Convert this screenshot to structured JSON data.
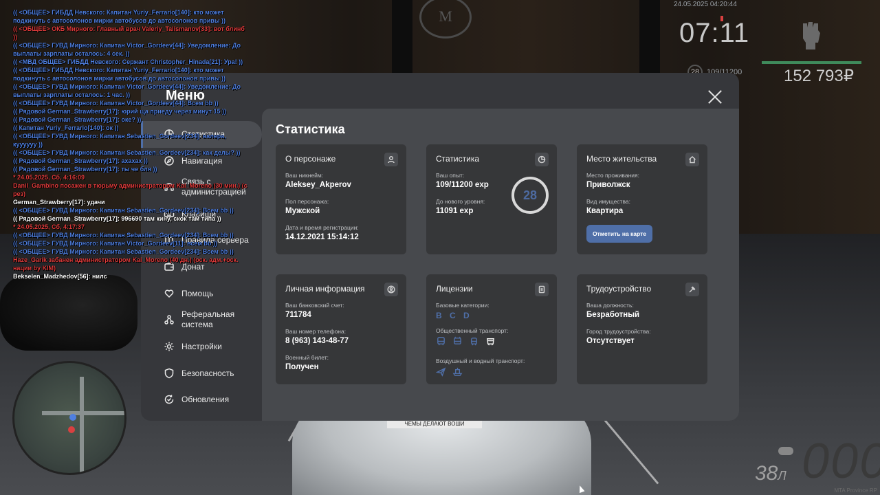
{
  "chat": [
    {
      "color": "blue",
      "text": "(( <ОБЩЕЕ> ГИБДД Невского: Капитан Yuriy_Ferrario[140]: кто может подкинуть с автосолонов мирки автобусов до автосолонов привы ))"
    },
    {
      "color": "red",
      "text": "(( <ОБЩЕЕ> ОКБ Мирного: Главный врач Valeriy_Talismanov[33]: вот блинб ))"
    },
    {
      "color": "blue",
      "text": "(( <ОБЩЕЕ> ГУВД Мирного: Капитан Victor_Gordeev[44]: Уведомление: До выплаты зарплаты осталось: 4 сек. ))"
    },
    {
      "color": "blue",
      "text": "(( <МВД ОБЩЕЕ> ГИБДД Невского: Сержант Christopher_Hinada[21]: Ура! ))"
    },
    {
      "color": "blue",
      "text": "(( <ОБЩЕЕ> ГИБДД Невского: Капитан Yuriy_Ferrario[140]: кто может подкинуть с автосолонов мирки автобусов до автосолонов привы ))"
    },
    {
      "color": "blue",
      "text": "(( <ОБЩЕЕ> ГУВД Мирного: Капитан Victor_Gordeev[44]: Уведомление: До выплаты зарплаты осталось: 1 час. ))"
    },
    {
      "color": "blue",
      "text": "(( <ОБЩЕЕ> ГУВД Мирного: Капитан Victor_Gordeev[44]: Всем bb ))"
    },
    {
      "color": "blue",
      "text": "(( Рядовой German_Strawberry[17]: юрий ща приеду через минут 15 ))"
    },
    {
      "color": "blue",
      "text": "(( Рядовой German_Strawberry[17]: оке? ))"
    },
    {
      "color": "blue",
      "text": "(( Капитан Yuriy_Ferrario[140]: ок ))"
    },
    {
      "color": "blue",
      "text": "(( <ОБЩЕЕ> ГУВД Мирного: Капитан Sebastien_Gordeev[234]: валера, куууууу ))"
    },
    {
      "color": "blue",
      "text": "(( <ОБЩЕЕ> ГУВД Мирного: Капитан Sebastien_Gordeev[234]: как делы? ))"
    },
    {
      "color": "blue",
      "text": "(( Рядовой German_Strawberry[17]: ахахах ))"
    },
    {
      "color": "blue",
      "text": "(( Рядовой German_Strawberry[17]: ты че бля ))"
    },
    {
      "color": "red",
      "text": "* 24.05.2025, Сб, 4:16:09"
    },
    {
      "color": "red",
      "text": "Danil_Gambino посажен в тюрьму администратором Kai_Moreno (30 мин.) (с рез)"
    },
    {
      "color": "white",
      "text": "German_Strawberry[17]: удачи"
    },
    {
      "color": "blue",
      "text": "(( <ОБЩЕЕ> ГУВД Мирного: Капитан Sebastien_Gordeev[234]: Всем bb ))"
    },
    {
      "color": "white",
      "text": "(( Рядовой German_Strawberry[17]: 996690 там кину, скок там типа ))"
    },
    {
      "color": "red",
      "text": "* 24.05.2025, Сб, 4:17:37"
    },
    {
      "color": "blue",
      "text": "(( <ОБЩЕЕ> ГУВД Мирного: Капитан Sebastien_Gordeev[234]: Всем bb ))"
    },
    {
      "color": "blue",
      "text": "(( <ОБЩЕЕ> ГУВД Мирного: Капитан Victor_Gordeev[11]: всем bb ))"
    },
    {
      "color": "blue",
      "text": "(( <ОБЩЕЕ> ГУВД Мирного: Капитан Sebastien_Gordeev[234]: Всем bb ))"
    },
    {
      "color": "red",
      "text": "Haze_Garik забанен администратором Kai_Moreno (40 дн.) (оск. адм.+оск. нации by KIM)"
    },
    {
      "color": "white",
      "text": "Bekselen_Madzhedov[56]: нилс"
    }
  ],
  "hud": {
    "datetime": "24.05.2025 04:20:44",
    "time": "07:11",
    "level": "28",
    "exp": "109/11200",
    "money": "152 793₽",
    "speed": "000",
    "fuel": "38",
    "fuel_unit": "Л",
    "watermark": "MTA Province RP"
  },
  "plate": "ЧЕМЫ ДЕЛАЮТ ВОШИ",
  "emblem": "M",
  "menu": {
    "title": "Меню",
    "nav": [
      {
        "name": "nav-statistics",
        "icon": "pie-chart-icon",
        "label": "Статистика",
        "active": true
      },
      {
        "name": "nav-navigation",
        "icon": "compass-icon",
        "label": "Навигация"
      },
      {
        "name": "nav-administration",
        "icon": "headset-icon",
        "label": "Связь с администрацией"
      },
      {
        "name": "nav-hotkeys",
        "icon": "keyboard-icon",
        "label": "Клавиши"
      },
      {
        "name": "nav-rules",
        "icon": "book-icon",
        "label": "Правила сервера"
      },
      {
        "name": "nav-donate",
        "icon": "wallet-icon",
        "label": "Донат"
      },
      {
        "name": "nav-help",
        "icon": "heart-hand-icon",
        "label": "Помощь"
      },
      {
        "name": "nav-referral",
        "icon": "network-icon",
        "label": "Реферальная система"
      },
      {
        "name": "nav-settings",
        "icon": "gear-icon",
        "label": "Настройки"
      },
      {
        "name": "nav-security",
        "icon": "shield-icon",
        "label": "Безопасность"
      },
      {
        "name": "nav-updates",
        "icon": "refresh-check-icon",
        "label": "Обновления"
      }
    ]
  },
  "content": {
    "title": "Статистика",
    "about": {
      "title": "О персонаже",
      "nick_label": "Ваш никнейм:",
      "nick": "Aleksey_Akperov",
      "gender_label": "Пол персонажа:",
      "gender": "Мужской",
      "reg_label": "Дата и время регистрации:",
      "reg": "14.12.2021 15:14:12"
    },
    "stats": {
      "title": "Статистика",
      "exp_label": "Ваш опыт:",
      "exp": "109/11200 exp",
      "next_label": "До нового уровня:",
      "next": "11091 exp",
      "level": "28"
    },
    "residence": {
      "title": "Место жительства",
      "place_label": "Место проживания:",
      "place": "Приволжск",
      "property_label": "Вид имущества:",
      "property": "Квартира",
      "map_button": "Отметить на карте"
    },
    "personal": {
      "title": "Личная информация",
      "bank_label": "Ваш банковский счет:",
      "bank": "711784",
      "phone_label": "Ваш номер телефона:",
      "phone": "8 (963) 143-48-77",
      "military_label": "Военный билет:",
      "military": "Получен"
    },
    "licenses": {
      "title": "Лицензии",
      "base_label": "Базовые категории:",
      "base": "B C D",
      "public_label": "Общественный транспорт:",
      "air_label": "Воздушный и водный транспорт:"
    },
    "job": {
      "title": "Трудоустройство",
      "position_label": "Ваша должность:",
      "position": "Безработный",
      "city_label": "Город трудоустройства:",
      "city": "Отсутствует"
    }
  },
  "colors": {
    "accent": "#4f6fa8",
    "chat_blue": "#4f7fe0",
    "chat_red": "#e03b3b",
    "modal_bg": "#36373b",
    "content_bg": "#47494d",
    "card_bg": "#363739"
  }
}
